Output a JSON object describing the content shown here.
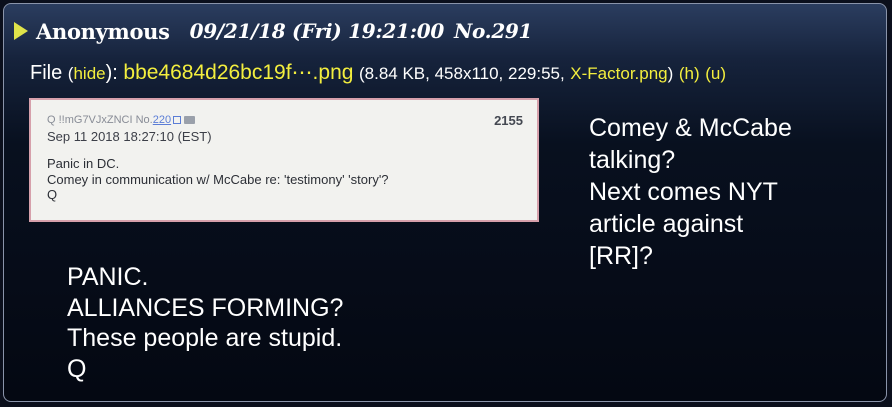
{
  "post": {
    "name": "Anonymous",
    "datetime": "09/21/18 (Fri) 19:21:00",
    "post_number": "No.291"
  },
  "file": {
    "label": "File",
    "open_paren": "(",
    "hide_link": "hide",
    "close_paren_colon": "):",
    "filename": "bbe4684d26bc19f⋯.png",
    "info_open": "(8.84 KB, 458x110, 229:55,",
    "original_name": "X-Factor.png",
    "info_close": ")",
    "h_link": "(h)",
    "u_link": "(u)"
  },
  "thumbnail": {
    "id_line": "Q !!mG7VJxZNCI No.",
    "ref_link": "220",
    "date": "Sep 11 2018 18:27:10 (EST)",
    "number": "2155",
    "line1": "Panic in DC.",
    "line2": "Comey in communication w/ McCabe re: 'testimony' 'story'?",
    "line3": "Q"
  },
  "side_text": "Comey & McCabe\ntalking?\nNext comes NYT\narticle against\n[RR]?",
  "main_text": "PANIC.\nALLIANCES FORMING?\nThese people are stupid.\nQ",
  "colors": {
    "accent_yellow": "#f3ee3e",
    "triangle": "#dfe34a",
    "thumbnail_border": "#d6a0ab"
  }
}
